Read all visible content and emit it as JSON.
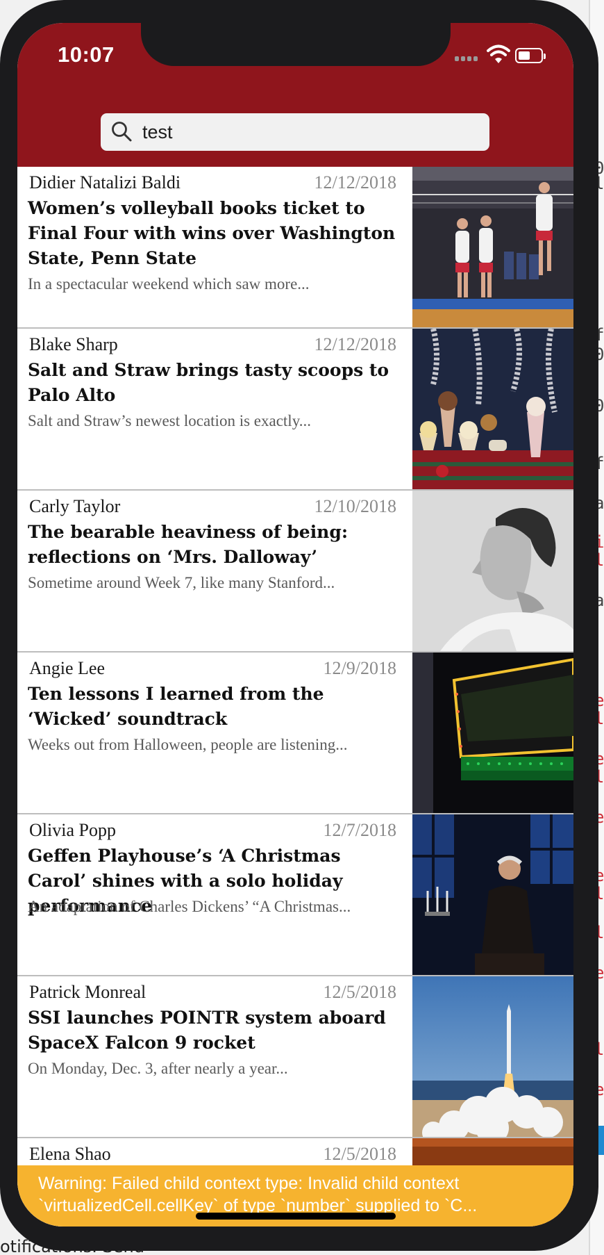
{
  "status_bar": {
    "time": "10:07"
  },
  "search": {
    "query": "test"
  },
  "articles": [
    {
      "author": "Didier Natalizi Baldi",
      "date": "12/12/2018",
      "headline": "Women’s volleyball books ticket to Final Four with wins over Washington State, Penn State",
      "snippet": "In a spectacular weekend which saw more..."
    },
    {
      "author": "Blake Sharp",
      "date": "12/12/2018",
      "headline": "Salt and Straw brings tasty scoops to Palo Alto",
      "snippet": "Salt and Straw’s newest location is exactly..."
    },
    {
      "author": "Carly Taylor",
      "date": "12/10/2018",
      "headline": "The bearable heaviness of being: reflections on ‘Mrs. Dalloway’",
      "snippet": "Sometime around Week 7, like many Stanford..."
    },
    {
      "author": "Angie Lee",
      "date": "12/9/2018",
      "headline": "Ten lessons I learned from the ‘Wicked’ soundtrack",
      "snippet": "Weeks out from Halloween, people are listening..."
    },
    {
      "author": "Olivia Popp",
      "date": "12/7/2018",
      "headline": "Geffen Playhouse’s ‘A Christmas Carol’ shines with a solo holiday performance",
      "snippet": "An adaptation of Charles Dickens’ “A Christmas..."
    },
    {
      "author": "Patrick Monreal",
      "date": "12/5/2018",
      "headline": "SSI launches POINTR system aboard SpaceX Falcon 9 rocket",
      "snippet": "On Monday, Dec. 3, after nearly a year..."
    },
    {
      "author": "Elena Shao",
      "date": "12/5/2018",
      "headline": "",
      "snippet": ""
    }
  ],
  "warning": {
    "line1": "Warning: Failed child context type: Invalid child context",
    "line2": "`virtualizedCell.cellKey` of type `number` supplied to `C..."
  },
  "background_text": "otifications. Send",
  "colors": {
    "header": "#8f151c",
    "warning": "#f6b32f"
  }
}
